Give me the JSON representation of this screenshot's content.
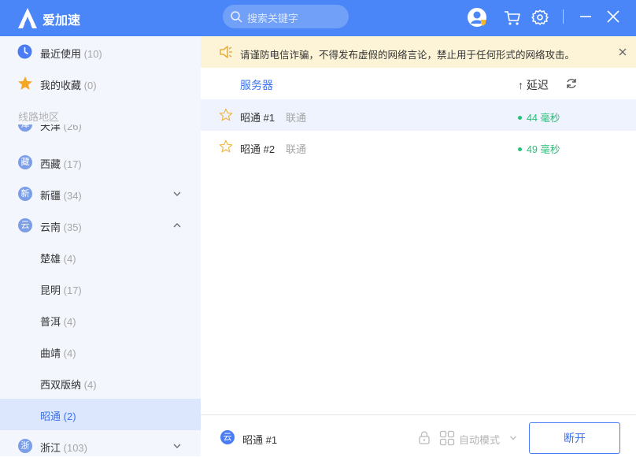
{
  "app": {
    "name": "爱加速"
  },
  "search": {
    "placeholder": "搜索关键字"
  },
  "sidebar": {
    "recent": {
      "label": "最近使用",
      "count": "(10)"
    },
    "favorites": {
      "label": "我的收藏",
      "count": "(0)"
    },
    "section_title": "线路地区",
    "regions": [
      {
        "badge": "津",
        "label": "天津",
        "count": "(26)"
      },
      {
        "badge": "藏",
        "label": "西藏",
        "count": "(17)"
      },
      {
        "badge": "新",
        "label": "新疆",
        "count": "(34)"
      },
      {
        "badge": "云",
        "label": "云南",
        "count": "(35)"
      },
      {
        "badge": "浙",
        "label": "浙江",
        "count": "(103)"
      }
    ],
    "cities": [
      {
        "label": "楚雄",
        "count": "(4)"
      },
      {
        "label": "昆明",
        "count": "(17)"
      },
      {
        "label": "普洱",
        "count": "(4)"
      },
      {
        "label": "曲靖",
        "count": "(4)"
      },
      {
        "label": "西双版纳",
        "count": "(4)"
      },
      {
        "label": "昭通",
        "count": "(2)"
      }
    ]
  },
  "notice": {
    "text": "请谨防电信诈骗，不得发布虚假的网络言论，禁止用于任何形式的网络攻击。"
  },
  "list": {
    "col_server": "服务器",
    "col_sort": "↑ 延迟",
    "servers": [
      {
        "name": "昭通 #1",
        "isp": "联通",
        "latency": "44 毫秒"
      },
      {
        "name": "昭通 #2",
        "isp": "联通",
        "latency": "49 毫秒"
      }
    ]
  },
  "bottom": {
    "current_badge": "云",
    "current_name": "昭通 #1",
    "mode_label": "自动模式",
    "disconnect_label": "断开"
  },
  "colors": {
    "accent": "#4a86f7",
    "latency": "#27c07a",
    "notice_bg": "#fdf4d8"
  }
}
